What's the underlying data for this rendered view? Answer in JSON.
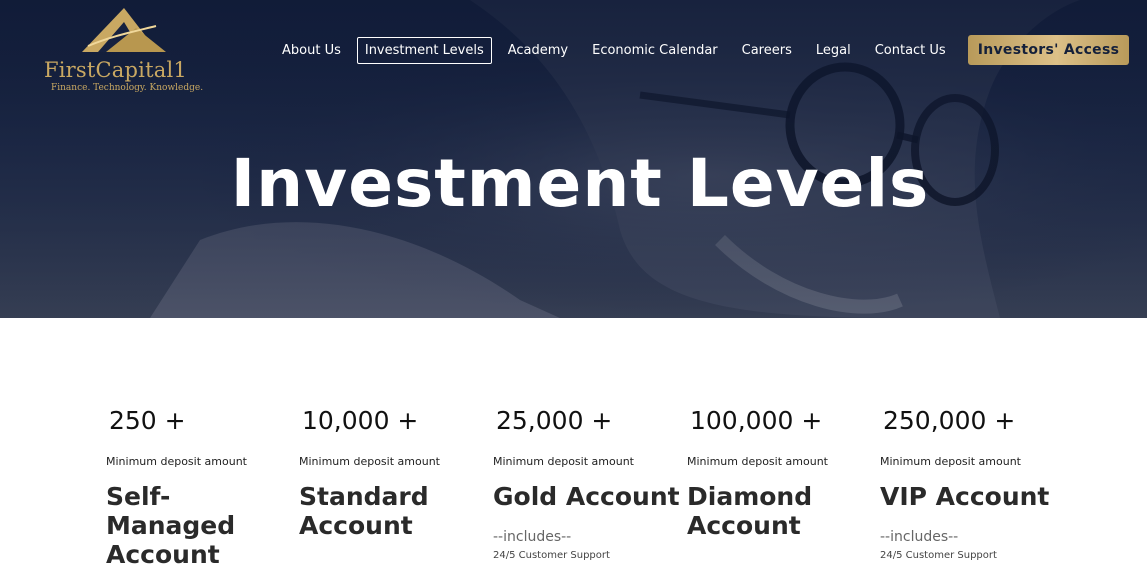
{
  "brand": {
    "logo_name": "FirstCapital1",
    "tagline": "Finance. Technology. Knowledge.",
    "gold": "#c9a862"
  },
  "nav": {
    "items": [
      {
        "label": "About Us",
        "active": false
      },
      {
        "label": "Investment Levels",
        "active": true
      },
      {
        "label": "Academy",
        "active": false
      },
      {
        "label": "Economic Calendar",
        "active": false
      },
      {
        "label": "Careers",
        "active": false
      },
      {
        "label": "Legal",
        "active": false
      },
      {
        "label": "Contact Us",
        "active": false
      }
    ],
    "cta_label": "Investors' Access"
  },
  "hero": {
    "title": "Investment Levels"
  },
  "levels": [
    {
      "amount": "250 +",
      "min_label": "Minimum deposit amount",
      "name": "Self-Managed Account",
      "includes": "",
      "support": ""
    },
    {
      "amount": "10,000 +",
      "min_label": "Minimum deposit amount",
      "name": "Standard Account",
      "includes": "",
      "support": ""
    },
    {
      "amount": "25,000 +",
      "min_label": "Minimum deposit amount",
      "name": "Gold Account",
      "includes": "--includes--",
      "support": "24/5 Customer Support"
    },
    {
      "amount": "100,000 +",
      "min_label": "Minimum deposit amount",
      "name": "Diamond Account",
      "includes": "",
      "support": ""
    },
    {
      "amount": "250,000 +",
      "min_label": "Minimum deposit amount",
      "name": "VIP Account",
      "includes": "--includes--",
      "support": "24/5 Customer Support"
    }
  ]
}
